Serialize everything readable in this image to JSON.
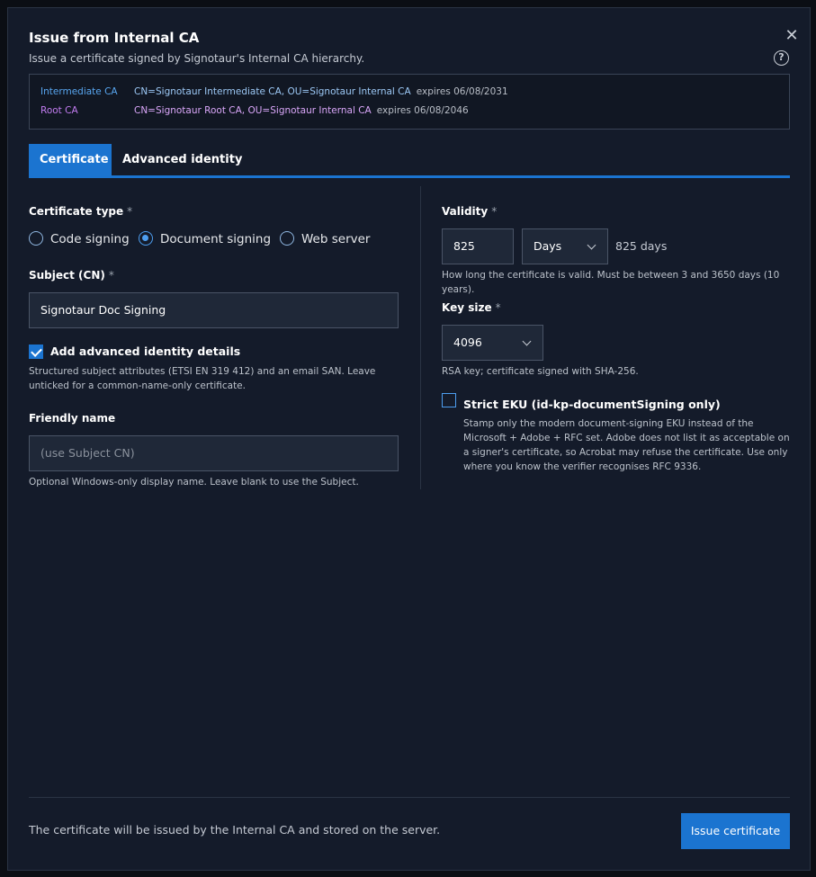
{
  "dialog": {
    "title": "Issue from Internal CA",
    "subtitle": "Issue a certificate signed by Signotaur's Internal CA hierarchy.",
    "close_glyph": "✕",
    "help_glyph": "?"
  },
  "chain": {
    "intermediate": {
      "label": "Intermediate CA",
      "dn": "CN=Signotaur Intermediate CA, OU=Signotaur Internal CA",
      "expires": "expires 06/08/2031"
    },
    "root": {
      "label": "Root CA",
      "dn": "CN=Signotaur Root CA, OU=Signotaur Internal CA",
      "expires": "expires 06/08/2046"
    }
  },
  "tabs": [
    {
      "label": "Certificate",
      "active": true
    },
    {
      "label": "Advanced identity",
      "active": false
    }
  ],
  "left": {
    "cert_type": {
      "label": "Certificate type",
      "required": "*",
      "options": [
        {
          "label": "Code signing",
          "checked": false
        },
        {
          "label": "Document signing",
          "checked": true
        },
        {
          "label": "Web server",
          "checked": false
        }
      ]
    },
    "subject": {
      "label": "Subject (CN)",
      "required": "*",
      "value": "Signotaur Doc Signing"
    },
    "advanced": {
      "label": "Add advanced identity details",
      "checked": true,
      "hint": "Structured subject attributes (ETSI EN 319 412) and an email SAN. Leave unticked for a common-name-only certificate."
    },
    "friendly": {
      "label": "Friendly name",
      "placeholder": "(use Subject CN)",
      "hint": "Optional Windows-only display name. Leave blank to use the Subject."
    }
  },
  "right": {
    "validity": {
      "label": "Validity",
      "required": "*",
      "value": "825",
      "unit": "Days",
      "summary": "825 days",
      "hint": "How long the certificate is valid. Must be between 3 and 3650 days (10 years)."
    },
    "keysize": {
      "label": "Key size",
      "required": "*",
      "value": "4096",
      "hint": "RSA key; certificate signed with SHA-256."
    },
    "strict_eku": {
      "label": "Strict EKU (id-kp-documentSigning only)",
      "checked": false,
      "hint": "Stamp only the modern document-signing EKU instead of the Microsoft + Adobe + RFC set. Adobe does not list it as acceptable on a signer's certificate, so Acrobat may refuse the certificate. Use only where you know the verifier recognises RFC 9336."
    }
  },
  "footer": {
    "note": "The certificate will be issued by the Internal CA and stored on the server.",
    "submit": "Issue certificate"
  },
  "colors": {
    "accent": "#1b74d0",
    "dialog_bg": "#141b2a",
    "intermediate": "#58a6f0",
    "root": "#c27cf0"
  }
}
